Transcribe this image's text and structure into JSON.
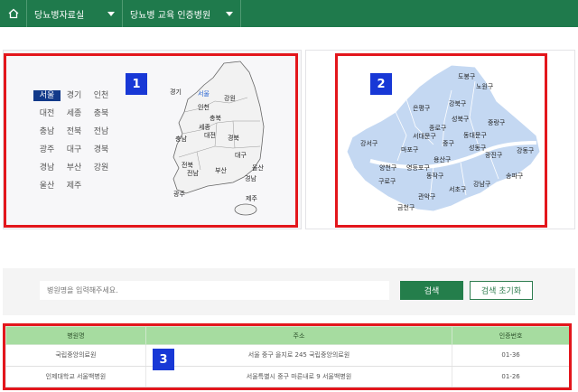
{
  "nav": {
    "menu1": "당뇨병자료실",
    "menu2": "당뇨병 교육 인증병원"
  },
  "markers": [
    "1",
    "2",
    "3"
  ],
  "regions": [
    "서울",
    "경기",
    "인천",
    "대전",
    "세종",
    "충북",
    "충남",
    "전북",
    "전남",
    "광주",
    "대구",
    "경북",
    "경남",
    "부산",
    "강원",
    "울산",
    "제주"
  ],
  "korea_map_labels": [
    "경기",
    "서울",
    "강원",
    "인천",
    "충북",
    "세종",
    "충남",
    "대전",
    "경북",
    "전북",
    "대구",
    "울산",
    "전남",
    "부산",
    "경남",
    "광주",
    "제주"
  ],
  "seoul_map_labels": [
    "도봉구",
    "노원구",
    "강북구",
    "은평구",
    "성북구",
    "종로구",
    "중랑구",
    "서대문구",
    "동대문구",
    "강서구",
    "마포구",
    "중구",
    "성동구",
    "광진구",
    "강동구",
    "용산구",
    "양천구",
    "영등포구",
    "동작구",
    "구로구",
    "서초구",
    "강남구",
    "송파구",
    "금천구",
    "관악구"
  ],
  "search": {
    "placeholder": "병원명을 입력해주세요.",
    "search_label": "검색",
    "reset_label": "검색 초기화"
  },
  "table": {
    "headers": [
      "병원명",
      "주소",
      "인증번호"
    ],
    "rows": [
      [
        "국립중앙의료원",
        "서울 중구 을지로 245 국립중앙의료원",
        "01-36"
      ],
      [
        "인제대학교 서울백병원",
        "서울특별시 중구 마른내로 9 서울백병원",
        "01-26"
      ]
    ]
  },
  "colors": {
    "nav_green": "#1f7a4c",
    "marker_red": "#e3161c",
    "badge_blue": "#1838d6",
    "table_header": "#a6dca0",
    "seoul_map_fill": "#c4d8f2"
  }
}
